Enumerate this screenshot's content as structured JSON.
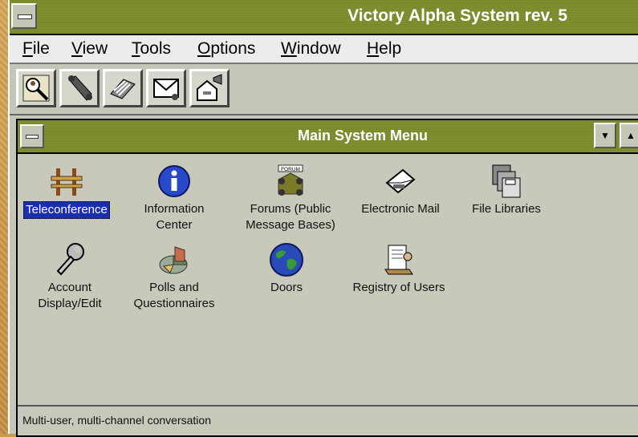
{
  "window": {
    "title": "Victory Alpha System rev. 5"
  },
  "menu": [
    {
      "pre": "",
      "key": "F",
      "post": "ile"
    },
    {
      "pre": "",
      "key": "V",
      "post": "iew"
    },
    {
      "pre": "",
      "key": "T",
      "post": "ools"
    },
    {
      "pre": "",
      "key": "O",
      "post": "ptions"
    },
    {
      "pre": "",
      "key": "W",
      "post": "indow"
    },
    {
      "pre": "",
      "key": "H",
      "post": "elp"
    }
  ],
  "toolbar": {
    "icons": [
      "user-search-icon",
      "telephone-icon",
      "rolodex-icon",
      "mail-envelope-icon",
      "announcement-house-icon"
    ]
  },
  "child_window": {
    "title": "Main System Menu",
    "programs_row1": [
      {
        "label": "Teleconference",
        "icon": "teleconference-icon",
        "selected": true
      },
      {
        "label": "Information\nCenter",
        "icon": "info-icon"
      },
      {
        "label": "Forums (Public\nMessage Bases)",
        "icon": "forum-icon",
        "icon_text": "FORUM"
      },
      {
        "label": "Electronic Mail",
        "icon": "mail-icon"
      },
      {
        "label": "File Libraries",
        "icon": "file-libraries-icon"
      }
    ],
    "programs_row2": [
      {
        "label": "Account\nDisplay/Edit",
        "icon": "wrench-icon"
      },
      {
        "label": "Polls and\nQuestionnaires",
        "icon": "pie-chart-icon"
      },
      {
        "label": "Doors",
        "icon": "globe-icon"
      },
      {
        "label": "Registry of Users",
        "icon": "registry-icon"
      }
    ],
    "status": "Multi-user, multi-channel conversation"
  },
  "colors": {
    "titlebar": "#7b8a2a",
    "selection": "#1a2fb0"
  }
}
